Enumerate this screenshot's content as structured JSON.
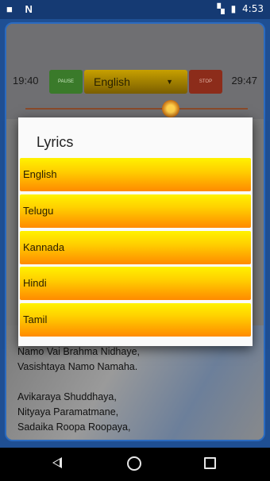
{
  "status_bar": {
    "left_icons": "N",
    "time": "4:53"
  },
  "player": {
    "elapsed_time": "19:40",
    "total_time": "29:47",
    "pause_label": "PAUSE",
    "language_value": "English",
    "stop_label": "STOP",
    "progress_fraction": 0.66
  },
  "lyrics_background": {
    "lines": [
      "Namo Vai Brahma Nidhaye,",
      "Vasishtaya Namo Namaha.",
      "",
      "Avikaraya Shuddhaya,",
      "Nityaya Paramatmane,",
      "Sadaika Roopa Roopaya,"
    ]
  },
  "dialog": {
    "title": "Lyrics",
    "options": [
      "English",
      "Telugu",
      "Kannada",
      "Hindi",
      "Tamil"
    ]
  }
}
